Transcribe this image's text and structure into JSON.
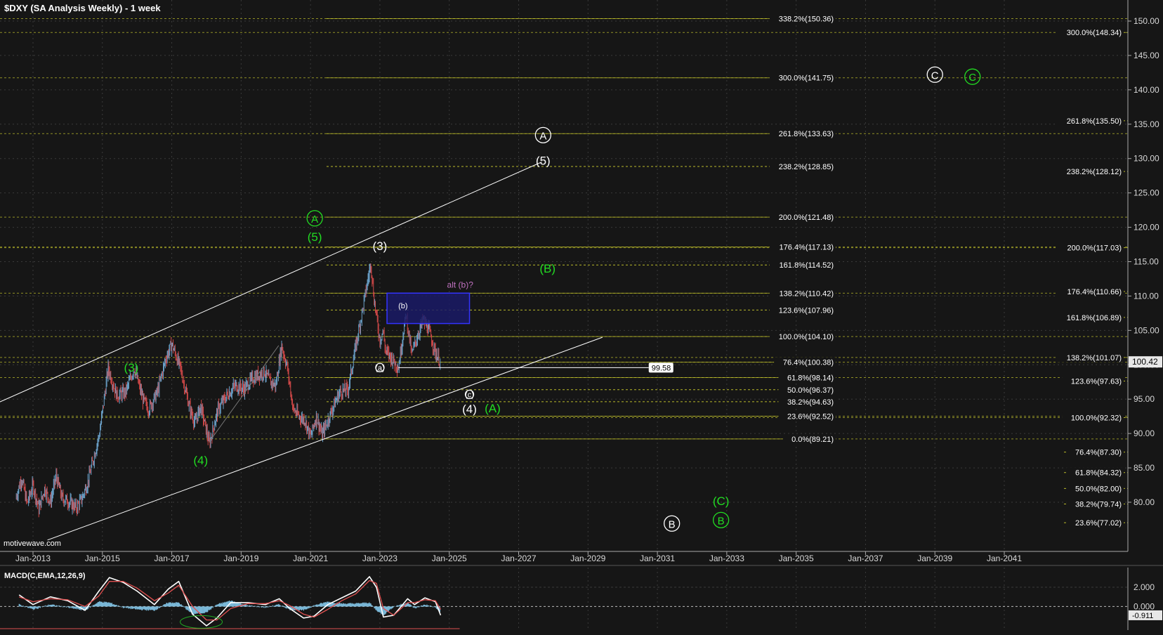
{
  "chart_title": "$DXY (SA Analysis Weekly) - 1 week",
  "watermark": "motivewave.com",
  "indicator_label": "MACD(C,EMA,12,26,9)",
  "colors": {
    "background": "#161616",
    "grid": "#3a3a3a",
    "price_up": "#6aa0c8",
    "price_down": "#d04848",
    "green": "#22dd22",
    "white": "#ffffff",
    "fib_line": "#b9b92a",
    "box_fill": "#1a1a66",
    "box_border": "#3333ff",
    "alt_label": "#c071c0",
    "macd_hist": "#7ab8d8",
    "macd_line": "#ffffff",
    "signal_line": "#e05050"
  },
  "chart_data": [
    {
      "type": "candlestick",
      "title": "$DXY (SA Analysis Weekly) - 1 week",
      "x_ticks": [
        "Jan-2013",
        "Jan-2015",
        "Jan-2017",
        "Jan-2019",
        "Jan-2021",
        "Jan-2023",
        "Jan-2025",
        "Jan-2027",
        "Jan-2029",
        "Jan-2031",
        "Jan-2033",
        "Jan-2035",
        "Jan-2037",
        "Jan-2039",
        "Jan-2041"
      ],
      "y_ticks": [
        80,
        85,
        90,
        95,
        100,
        105,
        110,
        115,
        120,
        125,
        130,
        135,
        140,
        145,
        150
      ],
      "ylim": [
        75,
        151
      ],
      "y_axis_side": "right",
      "grid": true,
      "current_price": "100.42",
      "price_path": [
        [
          "2012-07-01",
          80.5
        ],
        [
          "2012-09-01",
          83.5
        ],
        [
          "2012-11-01",
          79.8
        ],
        [
          "2013-01-01",
          82.5
        ],
        [
          "2013-03-01",
          79.0
        ],
        [
          "2013-05-01",
          82.0
        ],
        [
          "2013-07-01",
          80.0
        ],
        [
          "2013-09-01",
          83.8
        ],
        [
          "2013-11-01",
          80.6
        ],
        [
          "2014-01-01",
          80.2
        ],
        [
          "2014-04-01",
          79.2
        ],
        [
          "2014-06-01",
          80.6
        ],
        [
          "2014-08-01",
          83.0
        ],
        [
          "2014-10-01",
          86.5
        ],
        [
          "2014-12-01",
          90.0
        ],
        [
          "2015-03-01",
          99.5
        ],
        [
          "2015-06-01",
          95.5
        ],
        [
          "2015-09-01",
          96.0
        ],
        [
          "2015-12-01",
          99.5
        ],
        [
          "2016-03-01",
          95.0
        ],
        [
          "2016-05-01",
          93.5
        ],
        [
          "2016-08-01",
          96.0
        ],
        [
          "2016-11-01",
          101.0
        ],
        [
          "2017-01-01",
          103.0
        ],
        [
          "2017-04-01",
          99.5
        ],
        [
          "2017-07-01",
          94.0
        ],
        [
          "2017-09-01",
          91.5
        ],
        [
          "2017-11-01",
          94.0
        ],
        [
          "2018-02-01",
          88.5
        ],
        [
          "2018-05-01",
          93.5
        ],
        [
          "2018-08-01",
          95.5
        ],
        [
          "2018-11-01",
          97.0
        ],
        [
          "2019-02-01",
          96.5
        ],
        [
          "2019-05-01",
          98.0
        ],
        [
          "2019-09-01",
          99.0
        ],
        [
          "2019-11-01",
          97.5
        ],
        [
          "2020-01-01",
          97.0
        ],
        [
          "2020-03-01",
          102.8
        ],
        [
          "2020-05-01",
          99.5
        ],
        [
          "2020-07-01",
          93.5
        ],
        [
          "2020-09-01",
          92.5
        ],
        [
          "2020-11-01",
          92.0
        ],
        [
          "2021-01-01",
          89.5
        ],
        [
          "2021-03-01",
          92.5
        ],
        [
          "2021-05-01",
          89.8
        ],
        [
          "2021-08-01",
          93.0
        ],
        [
          "2021-11-01",
          96.0
        ],
        [
          "2022-02-01",
          96.5
        ],
        [
          "2022-05-01",
          103.5
        ],
        [
          "2022-07-01",
          108.0
        ],
        [
          "2022-09-27",
          114.8
        ],
        [
          "2022-11-01",
          109.5
        ],
        [
          "2023-01-01",
          103.5
        ],
        [
          "2023-02-01",
          105.0
        ],
        [
          "2023-03-01",
          102.0
        ],
        [
          "2023-05-01",
          101.0
        ],
        [
          "2023-07-14",
          99.58
        ],
        [
          "2023-09-01",
          104.5
        ],
        [
          "2023-10-03",
          107.3
        ],
        [
          "2023-12-01",
          101.5
        ],
        [
          "2024-02-01",
          104.2
        ],
        [
          "2024-04-01",
          106.5
        ],
        [
          "2024-06-01",
          105.0
        ],
        [
          "2024-08-01",
          102.0
        ],
        [
          "2024-09-27",
          100.42
        ]
      ],
      "trend_channel": {
        "upper": [
          [
            "2012-01-01",
            94.5
          ],
          [
            "2027-09-01",
            129.5
          ]
        ],
        "lower": [
          [
            "2013-06-01",
            74.5
          ],
          [
            "2029-06-01",
            104.0
          ]
        ],
        "connector_2017_2020": [
          [
            "2018-02-01",
            88.8
          ],
          [
            "2020-02-01",
            102.8
          ]
        ]
      },
      "support_line": {
        "from": "2023-07-14",
        "to": "2030-10-01",
        "value": "99.58"
      },
      "target_box": {
        "from": "2023-03-15",
        "to": "2025-08-01",
        "top": 110.42,
        "bottom": 106.0,
        "label": "alt (b)?"
      },
      "fib_levels_left": [
        {
          "label": "338.2%(150.36)",
          "value": 150.36
        },
        {
          "label": "300.0%(141.75)",
          "value": 141.75
        },
        {
          "label": "261.8%(133.63)",
          "value": 133.63
        },
        {
          "label": "238.2%(128.85)",
          "value": 128.85
        },
        {
          "label": "200.0%(121.48)",
          "value": 121.48
        },
        {
          "label": "176.4%(117.13)",
          "value": 117.13
        },
        {
          "label": "161.8%(114.52)",
          "value": 114.52
        },
        {
          "label": "138.2%(110.42)",
          "value": 110.42
        },
        {
          "label": "123.6%(107.96)",
          "value": 107.96
        },
        {
          "label": "100.0%(104.10)",
          "value": 104.1
        },
        {
          "label": "76.4%(100.38)",
          "value": 100.38
        },
        {
          "label": "61.8%(98.14)",
          "value": 98.14
        },
        {
          "label": "50.0%(96.37)",
          "value": 96.37
        },
        {
          "label": "38.2%(94.63)",
          "value": 94.63
        },
        {
          "label": "23.6%(92.52)",
          "value": 92.52
        },
        {
          "label": "0.0%(89.21)",
          "value": 89.21
        }
      ],
      "fib_levels_right": [
        {
          "label": "300.0%(148.34)",
          "value": 148.34
        },
        {
          "label": "261.8%(135.50)",
          "value": 135.5
        },
        {
          "label": "238.2%(128.12)",
          "value": 128.12
        },
        {
          "label": "200.0%(117.03)",
          "value": 117.03
        },
        {
          "label": "176.4%(110.66)",
          "value": 110.66
        },
        {
          "label": "161.8%(106.89)",
          "value": 106.89
        },
        {
          "label": "138.2%(101.07)",
          "value": 101.07
        },
        {
          "label": "123.6%(97.63)",
          "value": 97.63
        },
        {
          "label": "100.0%(92.32)",
          "value": 92.32
        },
        {
          "label": "76.4%(87.30)",
          "value": 87.3
        },
        {
          "label": "61.8%(84.32)",
          "value": 84.32
        },
        {
          "label": "50.0%(82.00)",
          "value": 82.0
        },
        {
          "label": "38.2%(79.74)",
          "value": 79.74
        },
        {
          "label": "23.6%(77.02)",
          "value": 77.02
        }
      ],
      "fib_extended_lines": [
        150.36,
        141.75,
        133.63,
        121.48,
        117.13,
        110.42,
        104.1,
        100.38,
        98.14,
        92.52,
        89.21,
        148.34,
        117.03,
        101.07,
        92.32
      ],
      "wave_labels": [
        {
          "text": "(3)",
          "date": "2015-11-01",
          "value": 99.0,
          "color": "green"
        },
        {
          "text": "(4)",
          "date": "2017-11-01",
          "value": 85.5,
          "color": "green"
        },
        {
          "text": "A",
          "date": "2021-02-15",
          "value": 120.7,
          "color": "green",
          "circled": true
        },
        {
          "text": "(5)",
          "date": "2021-02-15",
          "value": 118.0,
          "color": "green"
        },
        {
          "text": "(3)",
          "date": "2023-01-01",
          "value": 116.7,
          "color": "white"
        },
        {
          "text": "A",
          "date": "2027-09-15",
          "value": 132.8,
          "color": "white",
          "circled": true
        },
        {
          "text": "(5)",
          "date": "2027-09-15",
          "value": 129.1,
          "color": "white"
        },
        {
          "text": "(B)",
          "date": "2027-11-01",
          "value": 113.4,
          "color": "green"
        },
        {
          "text": "(b)",
          "date": "2023-09-01",
          "value": 108.2,
          "color": "white",
          "small": true
        },
        {
          "text": "(a)",
          "date": "2023-01-01",
          "value": 99.2,
          "color": "white",
          "small": true,
          "circled": true
        },
        {
          "text": "(c)",
          "date": "2025-08-01",
          "value": 95.3,
          "color": "white",
          "small": true,
          "circled": true
        },
        {
          "text": "(4)",
          "date": "2025-08-01",
          "value": 93.0,
          "color": "white"
        },
        {
          "text": "(A)",
          "date": "2026-04-01",
          "value": 93.1,
          "color": "green"
        },
        {
          "text": "C",
          "date": "2039-01-01",
          "value": 141.6,
          "color": "white",
          "circled": true
        },
        {
          "text": "C",
          "date": "2040-02-01",
          "value": 141.3,
          "color": "green",
          "circled": true
        },
        {
          "text": "(C)",
          "date": "2032-11-01",
          "value": 79.6,
          "color": "green"
        },
        {
          "text": "B",
          "date": "2032-11-01",
          "value": 76.8,
          "color": "green",
          "circled": true
        },
        {
          "text": "B",
          "date": "2031-06-01",
          "value": 76.3,
          "color": "white",
          "circled": true
        }
      ]
    },
    {
      "type": "line",
      "title": "MACD(C,EMA,12,26,9)",
      "y_ticks": [
        2.0,
        0.0
      ],
      "ylim": [
        -2.3,
        3.6
      ],
      "y_tick_labels": [
        "2.000",
        "0.000"
      ],
      "current_value": "-0.911",
      "series": [
        {
          "values": [
            [
              2012.6,
              1.2
            ],
            [
              2013.0,
              0.2
            ],
            [
              2013.5,
              1.0
            ],
            [
              2014.0,
              0.6
            ],
            [
              2014.5,
              -0.4
            ],
            [
              2014.9,
              1.6
            ],
            [
              2015.2,
              3.0
            ],
            [
              2015.6,
              2.5
            ],
            [
              2016.0,
              1.6
            ],
            [
              2016.5,
              0.2
            ],
            [
              2016.9,
              1.8
            ],
            [
              2017.2,
              2.6
            ],
            [
              2017.6,
              -0.8
            ],
            [
              2018.0,
              -2.0
            ],
            [
              2018.3,
              -1.2
            ],
            [
              2018.7,
              0.4
            ],
            [
              2019.2,
              0.4
            ],
            [
              2019.7,
              0.2
            ],
            [
              2020.1,
              0.8
            ],
            [
              2020.4,
              -0.2
            ],
            [
              2020.8,
              -1.2
            ],
            [
              2021.1,
              -1.0
            ],
            [
              2021.5,
              0.2
            ],
            [
              2021.9,
              0.9
            ],
            [
              2022.3,
              1.6
            ],
            [
              2022.7,
              3.1
            ],
            [
              2022.9,
              2.0
            ],
            [
              2023.1,
              -1.1
            ],
            [
              2023.4,
              -0.9
            ],
            [
              2023.8,
              0.8
            ],
            [
              2024.0,
              0.2
            ],
            [
              2024.3,
              0.9
            ],
            [
              2024.6,
              0.5
            ],
            [
              2024.75,
              -0.9
            ]
          ]
        },
        {
          "values": [
            [
              2012.6,
              1.0
            ],
            [
              2013.0,
              0.5
            ],
            [
              2013.5,
              0.8
            ],
            [
              2014.0,
              0.7
            ],
            [
              2014.5,
              0.0
            ],
            [
              2014.9,
              1.1
            ],
            [
              2015.2,
              2.6
            ],
            [
              2015.6,
              2.6
            ],
            [
              2016.0,
              1.9
            ],
            [
              2016.5,
              0.6
            ],
            [
              2016.9,
              1.4
            ],
            [
              2017.2,
              2.2
            ],
            [
              2017.6,
              0.0
            ],
            [
              2018.0,
              -1.4
            ],
            [
              2018.3,
              -1.4
            ],
            [
              2018.7,
              -0.2
            ],
            [
              2019.2,
              0.3
            ],
            [
              2019.7,
              0.3
            ],
            [
              2020.1,
              0.6
            ],
            [
              2020.4,
              0.1
            ],
            [
              2020.8,
              -0.8
            ],
            [
              2021.1,
              -1.1
            ],
            [
              2021.5,
              -0.3
            ],
            [
              2021.9,
              0.6
            ],
            [
              2022.3,
              1.3
            ],
            [
              2022.7,
              2.7
            ],
            [
              2022.9,
              2.4
            ],
            [
              2023.1,
              -0.2
            ],
            [
              2023.4,
              -0.9
            ],
            [
              2023.8,
              0.4
            ],
            [
              2024.0,
              0.4
            ],
            [
              2024.3,
              0.7
            ],
            [
              2024.6,
              0.6
            ],
            [
              2024.75,
              -0.3
            ]
          ]
        }
      ],
      "histogram": [
        [
          2012.6,
          0.2
        ],
        [
          2013.0,
          -0.3
        ],
        [
          2013.5,
          0.2
        ],
        [
          2014.0,
          -0.1
        ],
        [
          2014.5,
          -0.4
        ],
        [
          2014.9,
          0.5
        ],
        [
          2015.2,
          0.4
        ],
        [
          2015.6,
          -0.1
        ],
        [
          2016.0,
          -0.3
        ],
        [
          2016.5,
          -0.4
        ],
        [
          2016.9,
          0.4
        ],
        [
          2017.2,
          0.4
        ],
        [
          2017.6,
          -0.8
        ],
        [
          2018.0,
          -0.6
        ],
        [
          2018.3,
          0.2
        ],
        [
          2018.7,
          0.6
        ],
        [
          2019.2,
          0.1
        ],
        [
          2019.7,
          -0.1
        ],
        [
          2020.1,
          0.2
        ],
        [
          2020.4,
          -0.3
        ],
        [
          2020.8,
          -0.4
        ],
        [
          2021.1,
          0.1
        ],
        [
          2021.5,
          0.5
        ],
        [
          2021.9,
          0.3
        ],
        [
          2022.3,
          0.3
        ],
        [
          2022.7,
          0.4
        ],
        [
          2022.9,
          -0.4
        ],
        [
          2023.1,
          -0.9
        ],
        [
          2023.4,
          0.0
        ],
        [
          2023.8,
          0.4
        ],
        [
          2024.0,
          -0.2
        ],
        [
          2024.3,
          0.2
        ],
        [
          2024.6,
          -0.1
        ],
        [
          2024.75,
          -0.6
        ]
      ]
    }
  ]
}
